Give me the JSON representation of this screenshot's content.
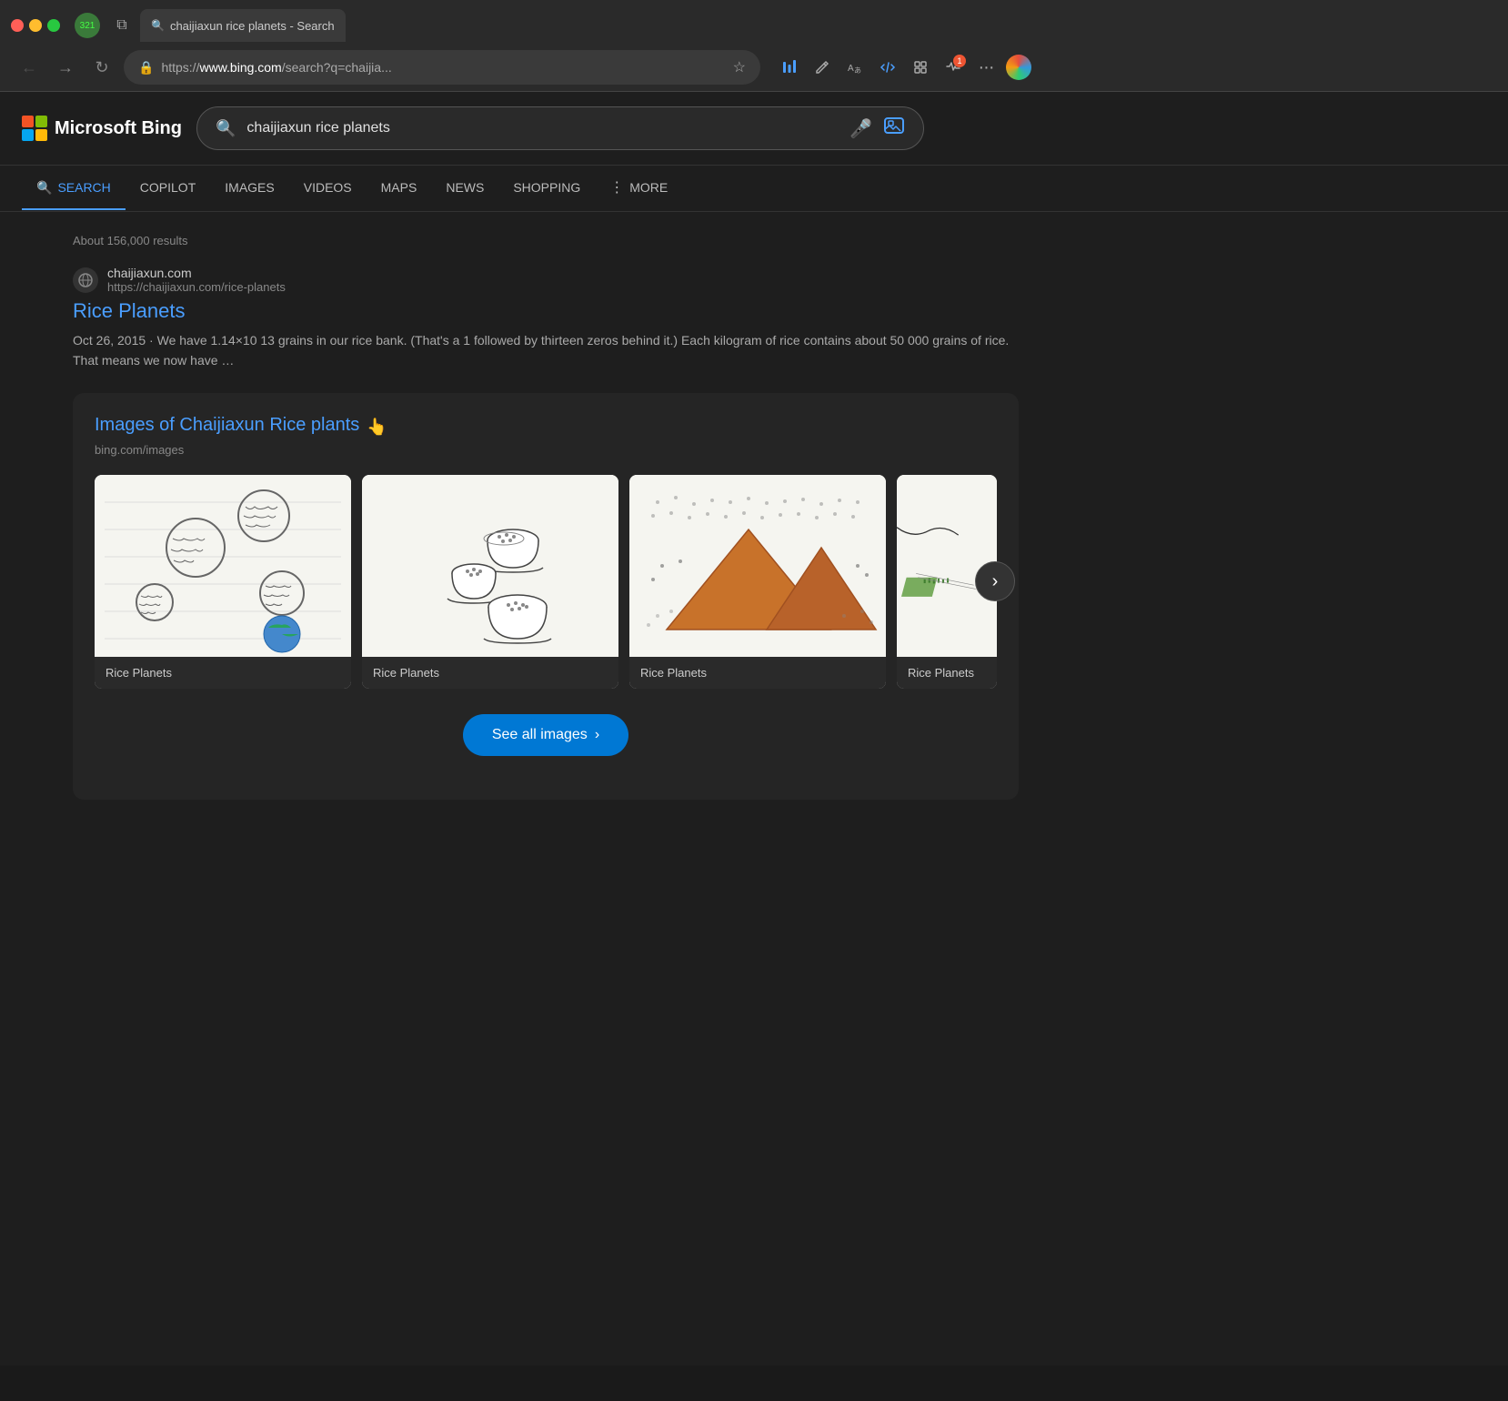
{
  "browser": {
    "tab_label": "chaijiaxun rice planets - Search",
    "tab_search_icon": "🔍",
    "url_prefix": "https://",
    "url_domain": "www.bing.com",
    "url_path": "/search?q=chaijia...",
    "url_full": "https://www.bing.com/search?q=chaijia...",
    "back_icon": "→",
    "refresh_icon": "↻",
    "lock_icon": "🔒",
    "star_icon": "☆",
    "more_icon": "···",
    "badge_count": "1"
  },
  "bing": {
    "logo_text": "Microsoft Bing",
    "search_query": "chaijiaxun rice planets",
    "nav_items": [
      {
        "label": "SEARCH",
        "active": true,
        "icon": "search"
      },
      {
        "label": "COPILOT",
        "active": false
      },
      {
        "label": "IMAGES",
        "active": false
      },
      {
        "label": "VIDEOS",
        "active": false
      },
      {
        "label": "MAPS",
        "active": false
      },
      {
        "label": "NEWS",
        "active": false
      },
      {
        "label": "SHOPPING",
        "active": false
      },
      {
        "label": "MORE",
        "active": false,
        "more": true
      }
    ],
    "results_count": "About 156,000 results",
    "result": {
      "domain": "chaijiaxun.com",
      "url": "https://chaijiaxun.com/rice-planets",
      "title": "Rice Planets",
      "description": "Oct 26, 2015 · We have 1.14×10 13 grains in our rice bank. (That's a 1 followed by thirteen zeros behind it.) Each kilogram of rice contains about 50 000 grains of rice. That means we now have …"
    },
    "images_section": {
      "title": "Images of Chaijiaxun Rice plants",
      "source": "bing.com/images",
      "cursor_icon": "👆",
      "images": [
        {
          "caption": "Rice Planets",
          "alt": "Sketched circular planets"
        },
        {
          "caption": "Rice Planets",
          "alt": "Rice bowls sketched"
        },
        {
          "caption": "Rice Planets",
          "alt": "Mountains with rice"
        },
        {
          "caption": "Rice Planets",
          "alt": "Rice field sketch"
        }
      ],
      "see_all_button": "See all images",
      "see_all_arrow": "›"
    }
  }
}
